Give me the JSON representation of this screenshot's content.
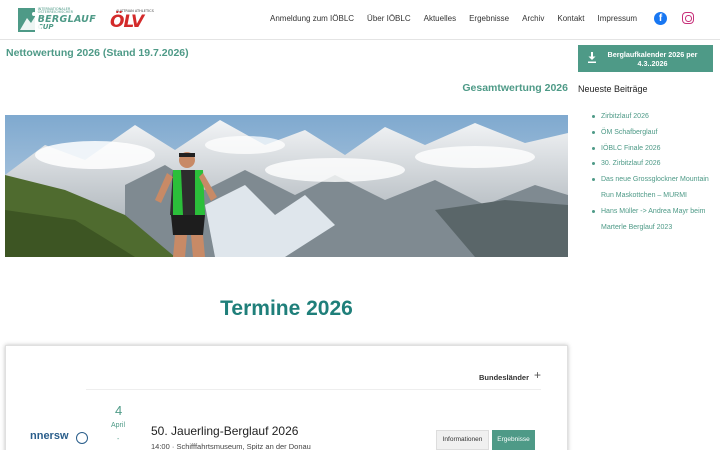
{
  "header": {
    "logo": {
      "line1": "INTERNATIONALER",
      "line2": "ÖSTERREICHISCHER",
      "title": "BERGLAUF",
      "cup": "CUP"
    },
    "olv": {
      "small": "AUSTRIAN ATHLETICS",
      "letters": "ÖLV"
    },
    "nav": [
      {
        "label": "Anmeldung zum IÖBLC"
      },
      {
        "label": "Über IÖBLC"
      },
      {
        "label": "Aktuelles"
      },
      {
        "label": "Ergebnisse"
      },
      {
        "label": "Archiv"
      },
      {
        "label": "Kontakt"
      },
      {
        "label": "Impressum"
      }
    ],
    "social": {
      "facebook_icon": "facebook-icon",
      "facebook_glyph": "f",
      "instagram_icon": "instagram-icon"
    }
  },
  "main": {
    "netto_title": "Nettowertung 2026 (Stand 19.7.2026)",
    "gesamt_title": "Gesamtwertung 2026",
    "termine_title": "Termine 2026",
    "events": {
      "filter_label": "Bundesländer",
      "filter_icon": "+",
      "items": [
        {
          "logo_text": "nnersw",
          "day": "4",
          "month": "April",
          "dash": "-",
          "title": "50. Jauerling-Berglauf 2026",
          "time": "14:00",
          "sep": "·",
          "location": "Schifffahrtsmuseum, Spitz an der Donau",
          "info_label": "Informationen",
          "results_label": "Ergebnisse"
        }
      ]
    }
  },
  "sidebar": {
    "calendar_button": "Berglaufkalender 2026 per 4.3..2026",
    "recent_title": "Neueste Beiträge",
    "posts": [
      {
        "label": "Zirbitzlauf 2026"
      },
      {
        "label": "ÖM Schafberglauf"
      },
      {
        "label": "IÖBLC Finale 2026"
      },
      {
        "label": "30. Zirbitzlauf 2026"
      },
      {
        "label": "Das neue Grossglockner Mountain Run Maskottchen – MURMI"
      },
      {
        "label": "Hans Müller -> Andrea Mayr beim Marterle Berglauf 2023"
      }
    ]
  },
  "colors": {
    "accent": "#4e9a87",
    "termine": "#1f7f7a",
    "olv_red": "#d32a2a",
    "facebook": "#1877f2",
    "instagram": "#c8307a"
  }
}
